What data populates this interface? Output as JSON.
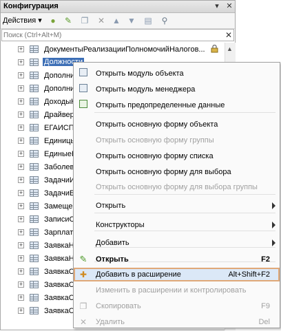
{
  "window": {
    "title": "Конфигурация",
    "buttons": [
      "▾",
      "✕"
    ]
  },
  "toolbar": {
    "actions_label": "Действия ▾",
    "icons": [
      "add-icon",
      "edit-icon",
      "copy-icon",
      "delete-icon",
      "move-up-icon",
      "move-down-icon",
      "properties-icon",
      "filter-icon"
    ]
  },
  "search": {
    "placeholder": "Поиск (Ctrl+Alt+M)",
    "clear": "✕"
  },
  "tree": {
    "items": [
      {
        "label": "ДокументыРеализацииПолномочийНалогов...",
        "selected": false
      },
      {
        "label": "Должности",
        "selected": true
      },
      {
        "label": "Дополни",
        "selected": false
      },
      {
        "label": "Дополни",
        "selected": false
      },
      {
        "label": "ДоходыН",
        "selected": false
      },
      {
        "label": "Драйвер",
        "selected": false
      },
      {
        "label": "ЕГАИСП",
        "selected": false
      },
      {
        "label": "Единиць",
        "selected": false
      },
      {
        "label": "ЕдиныеН",
        "selected": false
      },
      {
        "label": "Заболев",
        "selected": false
      },
      {
        "label": "ЗадачиИ",
        "selected": false
      },
      {
        "label": "ЗадачиБ",
        "selected": false
      },
      {
        "label": "Замеще",
        "selected": false
      },
      {
        "label": "ЗаписиС",
        "selected": false
      },
      {
        "label": "Зарплат",
        "selected": false
      },
      {
        "label": "ЗаявкаН",
        "selected": false
      },
      {
        "label": "ЗаявкаН",
        "selected": false
      },
      {
        "label": "ЗаявкаС",
        "selected": false
      },
      {
        "label": "ЗаявкаС",
        "selected": false
      },
      {
        "label": "ЗаявкаС",
        "selected": false
      },
      {
        "label": "ЗаявкаС",
        "selected": false
      }
    ]
  },
  "context_menu": {
    "items": [
      {
        "label": "Открыть модуль объекта",
        "shortcut": "",
        "icon": "module-icon",
        "disabled": false
      },
      {
        "label": "Открыть модуль менеджера",
        "shortcut": "",
        "icon": "module-icon",
        "disabled": false
      },
      {
        "label": "Открыть предопределенные данные",
        "shortcut": "",
        "icon": "predefined-data-icon",
        "disabled": false
      },
      {
        "label": "Открыть основную форму объекта",
        "shortcut": "",
        "icon": "",
        "disabled": false
      },
      {
        "label": "Открыть основную форму группы",
        "shortcut": "",
        "icon": "",
        "disabled": true
      },
      {
        "label": "Открыть основную форму списка",
        "shortcut": "",
        "icon": "",
        "disabled": false
      },
      {
        "label": "Открыть основную форму для выбора",
        "shortcut": "",
        "icon": "",
        "disabled": false
      },
      {
        "label": "Открыть основную форму для выбора группы",
        "shortcut": "",
        "icon": "",
        "disabled": true
      },
      {
        "label": "Открыть",
        "shortcut": "",
        "icon": "",
        "disabled": false,
        "submenu": true
      },
      {
        "label": "Конструкторы",
        "shortcut": "",
        "icon": "",
        "disabled": false,
        "submenu": true
      },
      {
        "label": "Добавить",
        "shortcut": "",
        "icon": "",
        "disabled": false,
        "submenu": true
      },
      {
        "label": "Открыть",
        "shortcut": "F2",
        "icon": "edit-icon",
        "disabled": false,
        "bold": true
      },
      {
        "label": "Добавить в расширение",
        "shortcut": "Alt+Shift+F2",
        "icon": "add-to-extension-icon",
        "disabled": false,
        "highlighted": true
      },
      {
        "label": "Изменить в расширении и контролировать",
        "shortcut": "",
        "icon": "",
        "disabled": true
      },
      {
        "label": "Скопировать",
        "shortcut": "F9",
        "icon": "copy-icon",
        "disabled": true
      },
      {
        "label": "Удалить",
        "shortcut": "Del",
        "icon": "delete-icon",
        "disabled": true
      }
    ]
  }
}
